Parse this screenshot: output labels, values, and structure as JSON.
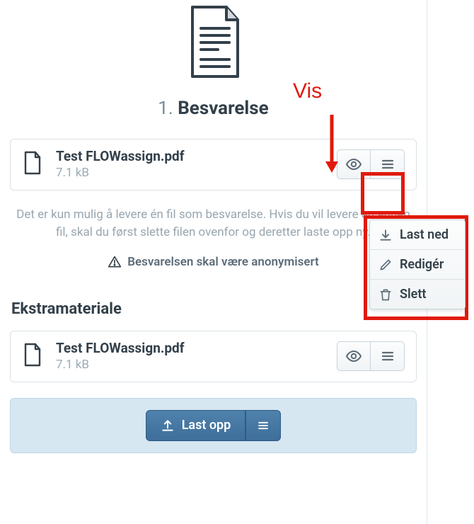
{
  "annotation": {
    "label": "Vis"
  },
  "besvarelse": {
    "title_num": "1.",
    "title_label": "Besvarelse",
    "file": {
      "name": "Test FLOWassign.pdf",
      "size": "7.1 kB"
    },
    "help": "Det er kun mulig å levere én fil som besvarelse. Hvis du vil levere en annen fil, skal du først slette filen ovenfor og deretter laste opp ny.",
    "anon_text": "Besvarelsen skal være anonymisert"
  },
  "menu": {
    "download": "Last ned",
    "edit": "Redigér",
    "delete": "Slett"
  },
  "ekstra": {
    "heading": "Ekstramateriale",
    "file": {
      "name": "Test FLOWassign.pdf",
      "size": "7.1 kB"
    }
  },
  "upload": {
    "label": "Last opp"
  }
}
